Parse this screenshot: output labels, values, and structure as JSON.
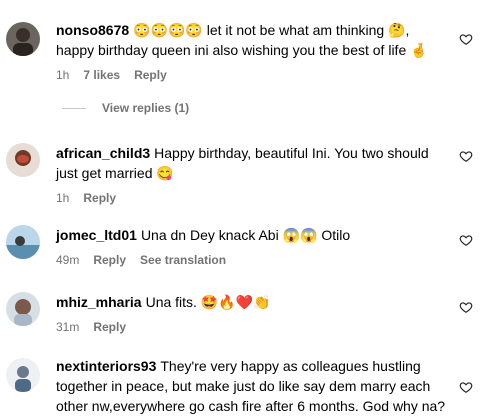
{
  "comments": [
    {
      "username": "nonso8678",
      "text_line1": "😳😳😳😳 let it not be what am thinking 🤔,",
      "text_line2": "happy birthday queen ini also wishing you the best of life 🤞",
      "time": "1h",
      "likes": "7 likes",
      "reply": "Reply",
      "view_replies": "View replies (1)"
    },
    {
      "username": "african_child3",
      "text_line1": "Happy birthday, beautiful Ini. You two should",
      "text_line2": "just get married 😋",
      "time": "1h",
      "reply": "Reply"
    },
    {
      "username": "jomec_ltd01",
      "text_line1": "Una dn Dey knack Abi 😱😱 Otilo",
      "time": "49m",
      "reply": "Reply",
      "see_translation": "See translation"
    },
    {
      "username": "mhiz_mharia",
      "text_line1": "Una fits. 🤩🔥❤️👏",
      "time": "31m",
      "reply": "Reply"
    },
    {
      "username": "nextinteriors93",
      "text_line1": "They're very happy as colleagues hustling",
      "text_line2": "together in peace, but make just do like say dem marry each",
      "text_line3": "other nw,everywhere go cash fire after 6 months. God why na?"
    }
  ],
  "icons": {
    "like": "heart-outline-icon"
  },
  "colors": {
    "meta": "#737373",
    "text": "#000000",
    "divider": "#c7c7c7"
  }
}
